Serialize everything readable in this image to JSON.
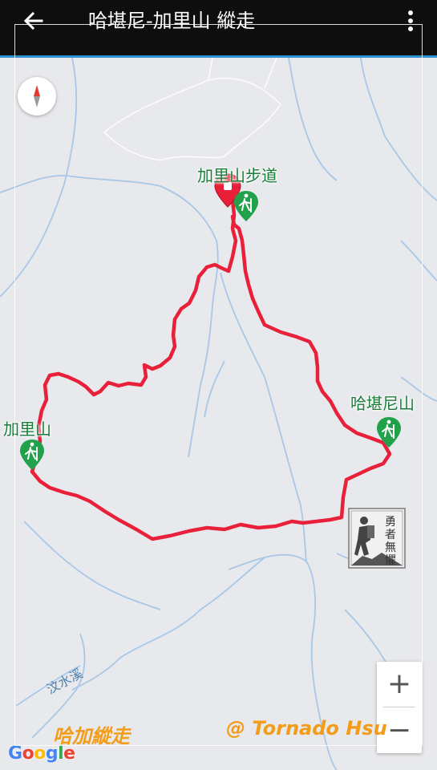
{
  "app_bar": {
    "back_icon": "arrow-left-icon",
    "title": "哈堪尼-加里山 縱走",
    "more_icon": "more-vert-icon"
  },
  "map": {
    "compass_icon": "compass-icon",
    "markers": [
      {
        "label": "加里山步道",
        "icon": "hiking-trail-icon"
      },
      {
        "label": "哈堪尼山",
        "icon": "hiking-trail-icon"
      },
      {
        "label": "加里山",
        "icon": "hiking-trail-icon"
      }
    ],
    "river_label": "汶水溪",
    "start_marker_icon": "location-pin-icon",
    "route_color": "#e8203a",
    "zoom_in": "+",
    "zoom_out": "−"
  },
  "watermark": {
    "left_text": "哈加縱走",
    "right_text": "@ Tornado Hsu",
    "stamp_text": "勇者無懼"
  },
  "attribution": {
    "google": "Google"
  }
}
